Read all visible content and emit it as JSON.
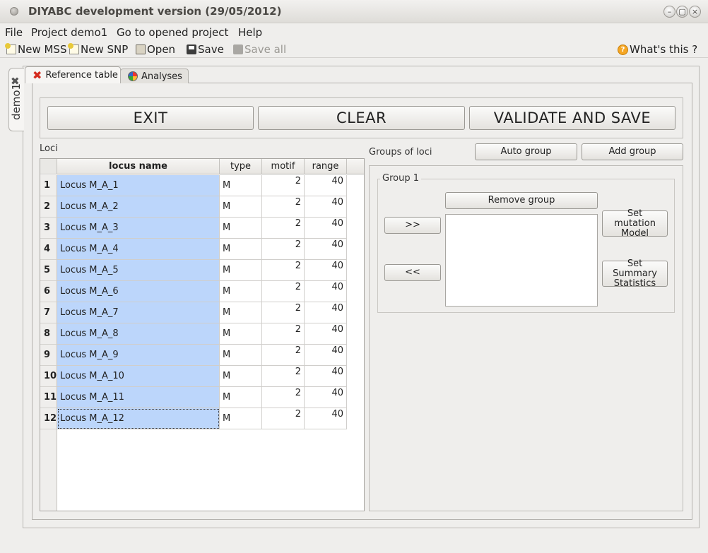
{
  "window": {
    "title": "DIYABC development version  (29/05/2012)",
    "controls": [
      "–",
      "▢",
      "×"
    ]
  },
  "menubar": {
    "items": [
      "File",
      "Project demo1",
      "Go to opened project",
      "Help"
    ]
  },
  "toolbar": {
    "new_mss": "New MSS",
    "new_snp": "New SNP",
    "open": "Open",
    "save": "Save",
    "save_all": "Save all",
    "whats_this": "What's this ?"
  },
  "project_tab": {
    "label": "demo1"
  },
  "tabs": [
    {
      "label": "Reference table",
      "icon": "close-x-icon"
    },
    {
      "label": "Analyses",
      "icon": "pie-chart-icon"
    }
  ],
  "actions": {
    "exit": "EXIT",
    "clear": "CLEAR",
    "validate": "VALIDATE AND SAVE"
  },
  "loci": {
    "title": "Loci",
    "columns": [
      "locus name",
      "type",
      "motif",
      "range"
    ],
    "rows": [
      {
        "num": "1",
        "name": "Locus M_A_1",
        "type": "M",
        "motif": "2",
        "range": "40"
      },
      {
        "num": "2",
        "name": "Locus M_A_2",
        "type": "M",
        "motif": "2",
        "range": "40"
      },
      {
        "num": "3",
        "name": "Locus M_A_3",
        "type": "M",
        "motif": "2",
        "range": "40"
      },
      {
        "num": "4",
        "name": "Locus M_A_4",
        "type": "M",
        "motif": "2",
        "range": "40"
      },
      {
        "num": "5",
        "name": "Locus M_A_5",
        "type": "M",
        "motif": "2",
        "range": "40"
      },
      {
        "num": "6",
        "name": "Locus M_A_6",
        "type": "M",
        "motif": "2",
        "range": "40"
      },
      {
        "num": "7",
        "name": "Locus M_A_7",
        "type": "M",
        "motif": "2",
        "range": "40"
      },
      {
        "num": "8",
        "name": "Locus M_A_8",
        "type": "M",
        "motif": "2",
        "range": "40"
      },
      {
        "num": "9",
        "name": "Locus M_A_9",
        "type": "M",
        "motif": "2",
        "range": "40"
      },
      {
        "num": "10",
        "name": "Locus M_A_10",
        "type": "M",
        "motif": "2",
        "range": "40"
      },
      {
        "num": "11",
        "name": "Locus M_A_11",
        "type": "M",
        "motif": "2",
        "range": "40"
      },
      {
        "num": "12",
        "name": "Locus M_A_12",
        "type": "M",
        "motif": "2",
        "range": "40"
      }
    ]
  },
  "groups": {
    "title": "Groups of loci",
    "auto_group": "Auto group",
    "add_group": "Add group",
    "group1": {
      "label": "Group 1",
      "remove": "Remove group",
      "add_arrow": ">>",
      "remove_arrow": "<<",
      "set_mutation": "Set mutation Model",
      "set_summary": "Set Summary Statistics"
    }
  },
  "colors": {
    "selection": "#bcd6fb",
    "window_bg": "#efeeec"
  }
}
